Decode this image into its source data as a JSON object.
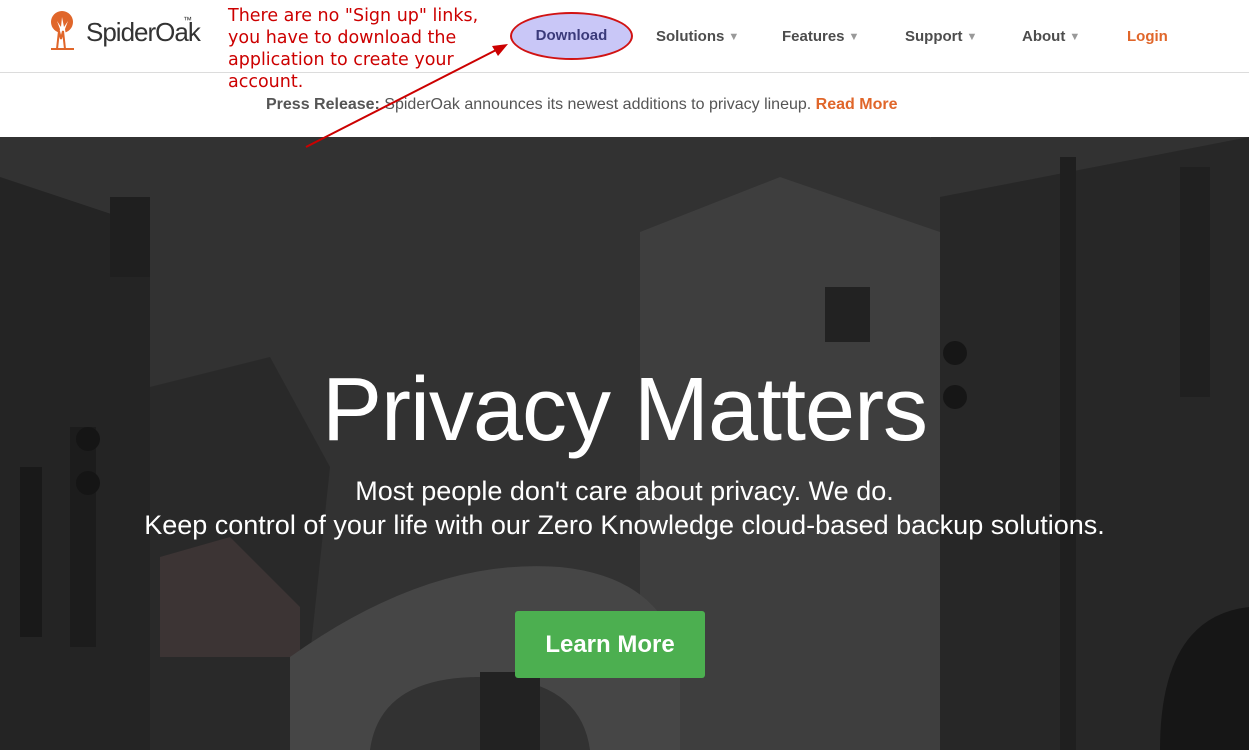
{
  "header": {
    "logo_text": "SpiderOak",
    "logo_tm": "™",
    "nav": {
      "download": "Download",
      "solutions": "Solutions",
      "features": "Features",
      "support": "Support",
      "about": "About",
      "login": "Login"
    }
  },
  "annotation": {
    "text": "There are no \"Sign up\" links, you have to download the application to create your account."
  },
  "press": {
    "label": "Press Release:",
    "text": " SpiderOak announces its newest additions to privacy lineup. ",
    "link": "Read More"
  },
  "hero": {
    "title": "Privacy Matters",
    "subtitle_1": "Most people don't care about privacy. We do.",
    "subtitle_2": "Keep control of your life with our Zero Knowledge cloud-based backup solutions.",
    "cta": "Learn More"
  },
  "colors": {
    "accent_orange": "#e0662a",
    "cta_green": "#4caf50",
    "annotation_red": "#cc0000",
    "download_highlight": "#c9c7f7"
  }
}
